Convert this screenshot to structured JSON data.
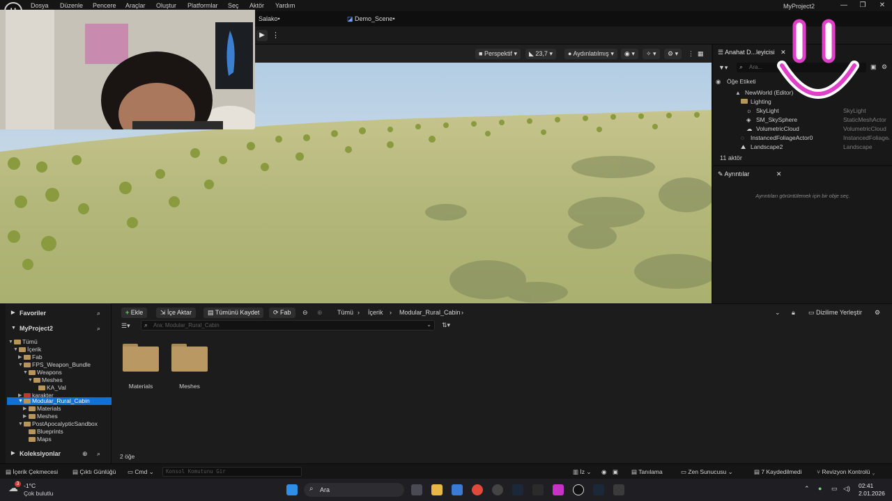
{
  "menu": {
    "items": [
      "Dosya",
      "Düzenle",
      "Pencere",
      "Araçlar",
      "Oluştur",
      "Platformlar",
      "Seç",
      "Aktör",
      "Yardım"
    ],
    "project_title": "MyProject2"
  },
  "tabs": {
    "tab1": "Salako•",
    "tab2": "Demo_Scene•"
  },
  "viewport": {
    "perspective": "Perspektif",
    "fov": "23,7",
    "lighting": "Aydınlatılmış"
  },
  "outliner": {
    "title": "Anahat D...leyicisi",
    "search_placeholder": "Ara...",
    "column_label": "Öğe Etiketi",
    "rows": [
      {
        "label": "NewWorld (Editor)",
        "type": ""
      },
      {
        "label": "Lighting",
        "type": ""
      },
      {
        "label": "SkyLight",
        "type": "SkyLight"
      },
      {
        "label": "SM_SkySphere",
        "type": "StaticMeshActor"
      },
      {
        "label": "VolumetricCloud",
        "type": "VolumetricCloud"
      },
      {
        "label": "InstancedFoliageActor0",
        "type": "InstancedFoliageActor"
      },
      {
        "label": "Landscape2",
        "type": "Landscape"
      }
    ],
    "status": "11 aktör"
  },
  "details": {
    "title": "Ayrıntılar",
    "empty_text": "Ayrıntıları görüntülemek için bir obje seç."
  },
  "content_browser": {
    "favorites": "Favoriler",
    "project": "MyProject2",
    "collections": "Koleksiyonlar",
    "tree": [
      {
        "label": "Tümü",
        "level": 0
      },
      {
        "label": "İçerik",
        "level": 1
      },
      {
        "label": "Fab",
        "level": 2
      },
      {
        "label": "FPS_Weapon_Bundle",
        "level": 2
      },
      {
        "label": "Weapons",
        "level": 3
      },
      {
        "label": "Meshes",
        "level": 4
      },
      {
        "label": "KA_Val",
        "level": 5
      },
      {
        "label": "karakter",
        "level": 2
      },
      {
        "label": "Modular_Rural_Cabin",
        "level": 2
      },
      {
        "label": "Materials",
        "level": 3
      },
      {
        "label": "Meshes",
        "level": 3
      },
      {
        "label": "PostApocalypticSandbox",
        "level": 2
      },
      {
        "label": "Blueprints",
        "level": 3
      },
      {
        "label": "Maps",
        "level": 3
      }
    ],
    "buttons": {
      "add": "Ekle",
      "import": "İçe Aktar",
      "save_all": "Tümünü Kaydet",
      "fab": "Fab"
    },
    "breadcrumb": [
      "Tümü",
      "İçerik",
      "Modular_Rural_Cabin"
    ],
    "dock_label": "Dizilime Yerleştir",
    "search_placeholder": "Ara: Modular_Rural_Cabin",
    "assets": [
      "Materials",
      "Meshes"
    ],
    "item_count": "2 öğe"
  },
  "statusbar": {
    "content_drawer": "İçerik Çekmecesi",
    "output_log": "Çıktı Günlüğü",
    "cmd": "Cmd",
    "console_placeholder": "Konsol Komutunu Gir",
    "trace": "İz",
    "diagnostics": "Tanılama",
    "zen_server": "Zen Sunucusu",
    "saved": "7 Kaydedilmedi",
    "revision": "Revizyon Kontrolü"
  },
  "taskbar": {
    "weather_temp": "-1°C",
    "weather_desc": "Çok bulutlu",
    "search_label": "Ara",
    "time": "02:41",
    "date": "2.01.2026",
    "badge": "3"
  },
  "colors": {
    "accent_blue": "#0e72d6",
    "folder": "#b99863",
    "overlay_pink": "#e040c8"
  }
}
